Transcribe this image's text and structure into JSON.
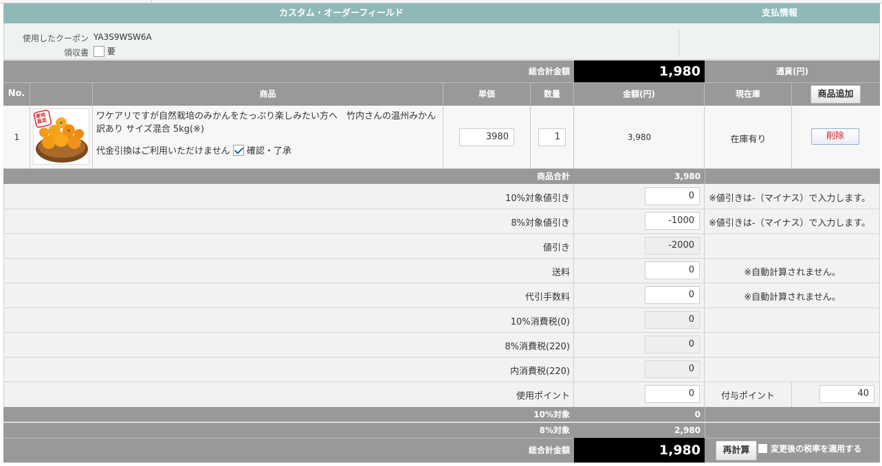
{
  "header": {
    "custom_fields_title": "カスタム・オーダーフィールド",
    "payment_title": "支払情報"
  },
  "custom_fields": {
    "coupon_label": "使用したクーポン",
    "coupon_value": "YA3S9WSW6A",
    "receipt_label": "領収書",
    "receipt_option": "要"
  },
  "top_total": {
    "label": "総合計金額",
    "value": "1,980",
    "currency": "通貨(円)"
  },
  "table_headers": {
    "no": "No.",
    "product": "商品",
    "unit_price": "単価",
    "quantity": "数量",
    "amount": "金額(円)",
    "stock": "現在庫",
    "add_product": "商品追加"
  },
  "items": [
    {
      "no": "1",
      "image_badge": "産地直送",
      "name": "ワケアリですが自然栽培のみかんをたっぷり楽しみたい方へ　竹内さんの温州みかん訳あり サイズ混合 5kg(※)",
      "cod_note": "代金引換はご利用いただけません",
      "cod_confirm": "確認・了承",
      "unit_price": "3980",
      "quantity": "1",
      "amount": "3,980",
      "stock": "在庫有り",
      "delete_label": "削除"
    }
  ],
  "subtotal": {
    "label": "商品合計",
    "value": "3,980"
  },
  "adjustments": {
    "discount10_label": "10%対象値引き",
    "discount10_value": "0",
    "discount8_label": "8%対象値引き",
    "discount8_value": "-1000",
    "discount_note": "※値引きは-（マイナス）で入力します。",
    "discount_label": "値引き",
    "discount_value": "-2000",
    "shipping_label": "送料",
    "shipping_value": "0",
    "cod_fee_label": "代引手数料",
    "cod_fee_value": "0",
    "auto_note": "※自動計算されません。",
    "tax10_label": "10%消費税(0)",
    "tax10_value": "0",
    "tax8_label": "8%消費税(220)",
    "tax8_value": "0",
    "inner_tax_label": "内消費税(220)",
    "inner_tax_value": "0",
    "use_point_label": "使用ポイント",
    "use_point_value": "0",
    "grant_point_label": "付与ポイント",
    "grant_point_value": "40"
  },
  "summary": {
    "target10_label": "10%対象",
    "target10_value": "0",
    "target8_label": "8%対象",
    "target8_value": "2,980",
    "total_label": "総合計金額",
    "total_value": "1,980",
    "recalc_label": "再計算",
    "apply_rate_label": "変更後の税率を適用する"
  },
  "colors": {
    "header_teal": "#8fb9b8",
    "row_gray": "#999999",
    "total_black": "#000000",
    "delete_red": "#cc2222"
  }
}
